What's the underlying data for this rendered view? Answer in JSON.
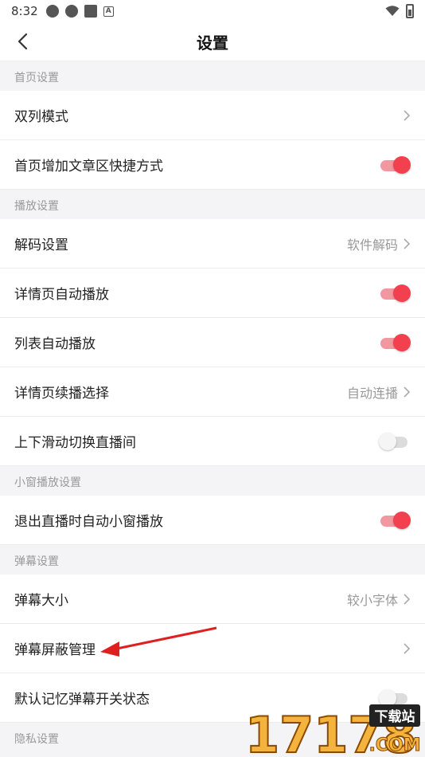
{
  "status": {
    "time": "8:32"
  },
  "header": {
    "title": "设置"
  },
  "sections": {
    "home": {
      "title": "首页设置",
      "double_column": "双列模式",
      "shortcut": "首页增加文章区快捷方式"
    },
    "playback": {
      "title": "播放设置",
      "decode": "解码设置",
      "decode_value": "软件解码",
      "detail_autoplay": "详情页自动播放",
      "list_autoplay": "列表自动播放",
      "continue_select": "详情页续播选择",
      "continue_value": "自动连播",
      "swipe_live": "上下滑动切换直播间"
    },
    "mini_window": {
      "title": "小窗播放设置",
      "exit_live_mini": "退出直播时自动小窗播放"
    },
    "danmaku": {
      "title": "弹幕设置",
      "size": "弹幕大小",
      "size_value": "较小字体",
      "block_manage": "弹幕屏蔽管理",
      "remember_state": "默认记忆弹幕开关状态"
    },
    "privacy": {
      "title": "隐私设置"
    }
  },
  "toggles": {
    "shortcut": true,
    "detail_autoplay": true,
    "list_autoplay": true,
    "swipe_live": false,
    "exit_live_mini": true,
    "remember_state": false
  },
  "colors": {
    "accent": "#f3404e",
    "annotation_arrow": "#e02020"
  },
  "watermark": {
    "number": "17178",
    "tag": "下载站",
    "domain": ".COM"
  }
}
